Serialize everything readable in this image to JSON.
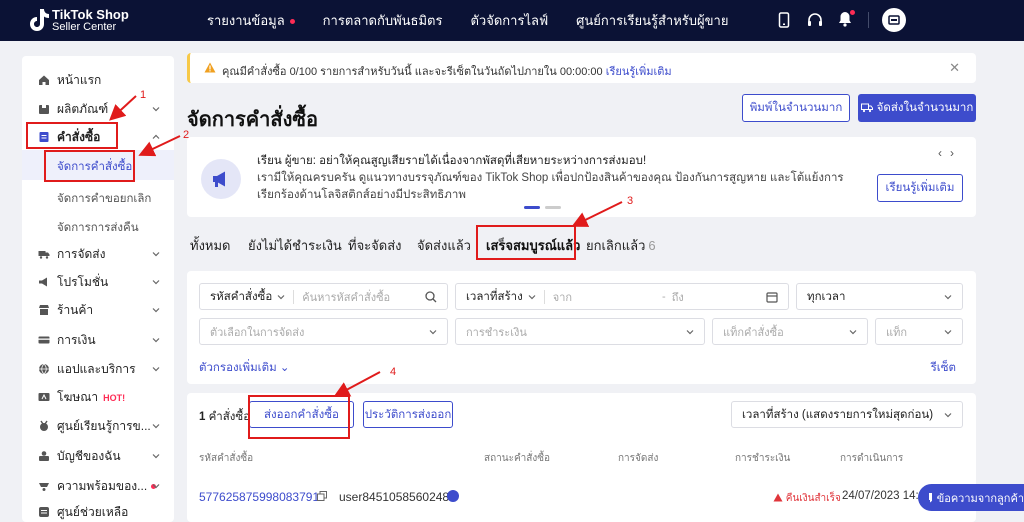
{
  "header": {
    "logo_line1": "TikTok Shop",
    "logo_line2": "Seller Center",
    "nav": [
      "รายงานข้อมูล",
      "การตลาดกับพันธมิตร",
      "ตัวจัดการไลฟ์",
      "ศูนย์การเรียนรู้สำหรับผู้ขาย"
    ]
  },
  "sidebar": {
    "items": [
      {
        "label": "หน้าแรก",
        "icon": "home-icon"
      },
      {
        "label": "ผลิตภัณฑ์",
        "icon": "box-icon"
      },
      {
        "label": "คำสั่งซื้อ",
        "icon": "order-icon"
      },
      {
        "label": "การจัดส่ง",
        "icon": "truck-icon"
      },
      {
        "label": "โปรโมชั่น",
        "icon": "megaphone-icon"
      },
      {
        "label": "ร้านค้า",
        "icon": "shop-icon"
      },
      {
        "label": "การเงิน",
        "icon": "card-icon"
      },
      {
        "label": "แอปและบริการ",
        "icon": "globe-icon"
      },
      {
        "label": "โฆษณา",
        "icon": "ad-icon",
        "badge": "HOT!"
      },
      {
        "label": "ศูนย์เรียนรู้การข...",
        "icon": "medal-icon"
      },
      {
        "label": "บัญชีของฉัน",
        "icon": "account-icon"
      },
      {
        "label": "ความพร้อมของ...",
        "icon": "readiness-icon"
      },
      {
        "label": "ศูนย์ช่วยเหลือ",
        "icon": "help-icon"
      }
    ],
    "order_subitems": [
      "จัดการคำสั่งซื้อ",
      "จัดการคำขอยกเลิก",
      "จัดการการส่งคืน"
    ]
  },
  "notice": {
    "text": "คุณมีคำสั่งซื้อ 0/100 รายการสำหรับวันนี้ และจะรีเซ็ตในวันถัดไปภายใน 00:00:00",
    "link": "เรียนรู้เพิ่มเติม"
  },
  "page": {
    "title": "จัดการคำสั่งซื้อ",
    "print_bulk": "พิมพ์ในจำนวนมาก",
    "ship_bulk": "จัดส่งในจำนวนมาก"
  },
  "banner": {
    "line1": "เรียน ผู้ขาย: อย่าให้คุณสูญเสียรายได้เนื่องจากพัสดุที่เสียหายระหว่างการส่งมอบ!",
    "line2": "เรามีให้คุณครบครัน ดูแนวทางบรรจุภัณฑ์ของ TikTok Shop เพื่อปกป้องสินค้าของคุณ ป้องกันการสูญหาย และโต้แย้งการเรียกร้องด้านโลจิสติกส์อย่างมีประสิทธิภาพ",
    "button": "เรียนรู้เพิ่มเติม"
  },
  "tabs": [
    {
      "label": "ทั้งหมด"
    },
    {
      "label": "ยังไม่ได้ชำระเงิน"
    },
    {
      "label": "ที่จะจัดส่ง"
    },
    {
      "label": "จัดส่งแล้ว"
    },
    {
      "label": "เสร็จสมบูรณ์แล้ว"
    },
    {
      "label": "ยกเลิกแล้ว",
      "count": "6"
    }
  ],
  "filters": {
    "order_id_label": "รหัสคำสั่งซื้อ",
    "order_id_placeholder": "ค้นหารหัสคำสั่งซื้อ",
    "created_label": "เวลาที่สร้าง",
    "from": "จาก",
    "to": "ถึง",
    "all_time": "ทุกเวลา",
    "shipping_option": "ตัวเลือกในการจัดส่ง",
    "payment": "การชำระเงิน",
    "order_tag": "แท็กคำสั่งซื้อ",
    "tag": "แท็ก",
    "more_filters": "ตัวกรองเพิ่มเติม",
    "reset": "รีเซ็ต"
  },
  "results": {
    "count": "1",
    "count_suffix": "คำสั่งซื้อ",
    "export": "ส่งออกคำสั่งซื้อ",
    "export_history": "ประวัติการส่งออก",
    "sort": "เวลาที่สร้าง (แสดงรายการใหม่สุดก่อน)",
    "columns": [
      "รหัสคำสั่งซื้อ",
      "สถานะคำสั่งซื้อ",
      "การจัดส่ง",
      "การชำระเงิน",
      "การดำเนินการ"
    ],
    "rows": [
      {
        "order_id": "577625875998083791",
        "buyer": "user8451058560248",
        "status": "คืนเงินสำเร็จ",
        "date": "24/07/2023 14:"
      }
    ]
  },
  "chat_fab": "ข้อความจากลูกค้า",
  "annotations": [
    "1",
    "2",
    "3",
    "4"
  ],
  "colors": {
    "accent": "#3d4ccc",
    "topbar": "#0b1235",
    "annotation": "#e01b1b"
  }
}
